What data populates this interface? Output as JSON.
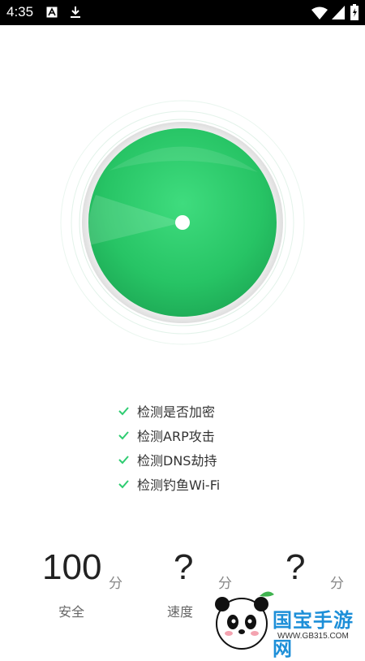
{
  "status_bar": {
    "time": "4:35",
    "left_icons": [
      "a-box-icon",
      "download-icon"
    ],
    "right_icons": [
      "wifi-icon",
      "signal-icon",
      "battery-charging-icon"
    ]
  },
  "scan": {
    "accent_color": "#2ecc71",
    "items": [
      {
        "label": "检测是否加密",
        "icon": "check-icon"
      },
      {
        "label": "检测ARP攻击",
        "icon": "check-icon"
      },
      {
        "label": "检测DNS劫持",
        "icon": "check-icon"
      },
      {
        "label": "检测钓鱼Wi-Fi",
        "icon": "check-icon"
      }
    ]
  },
  "scores": [
    {
      "value": "100",
      "unit": "分",
      "label": "安全"
    },
    {
      "value": "?",
      "unit": "分",
      "label": "速度"
    },
    {
      "value": "?",
      "unit": "分",
      "label": ""
    }
  ],
  "watermark": {
    "brand": "国宝手游网",
    "url": "WWW.GB315.COM"
  }
}
